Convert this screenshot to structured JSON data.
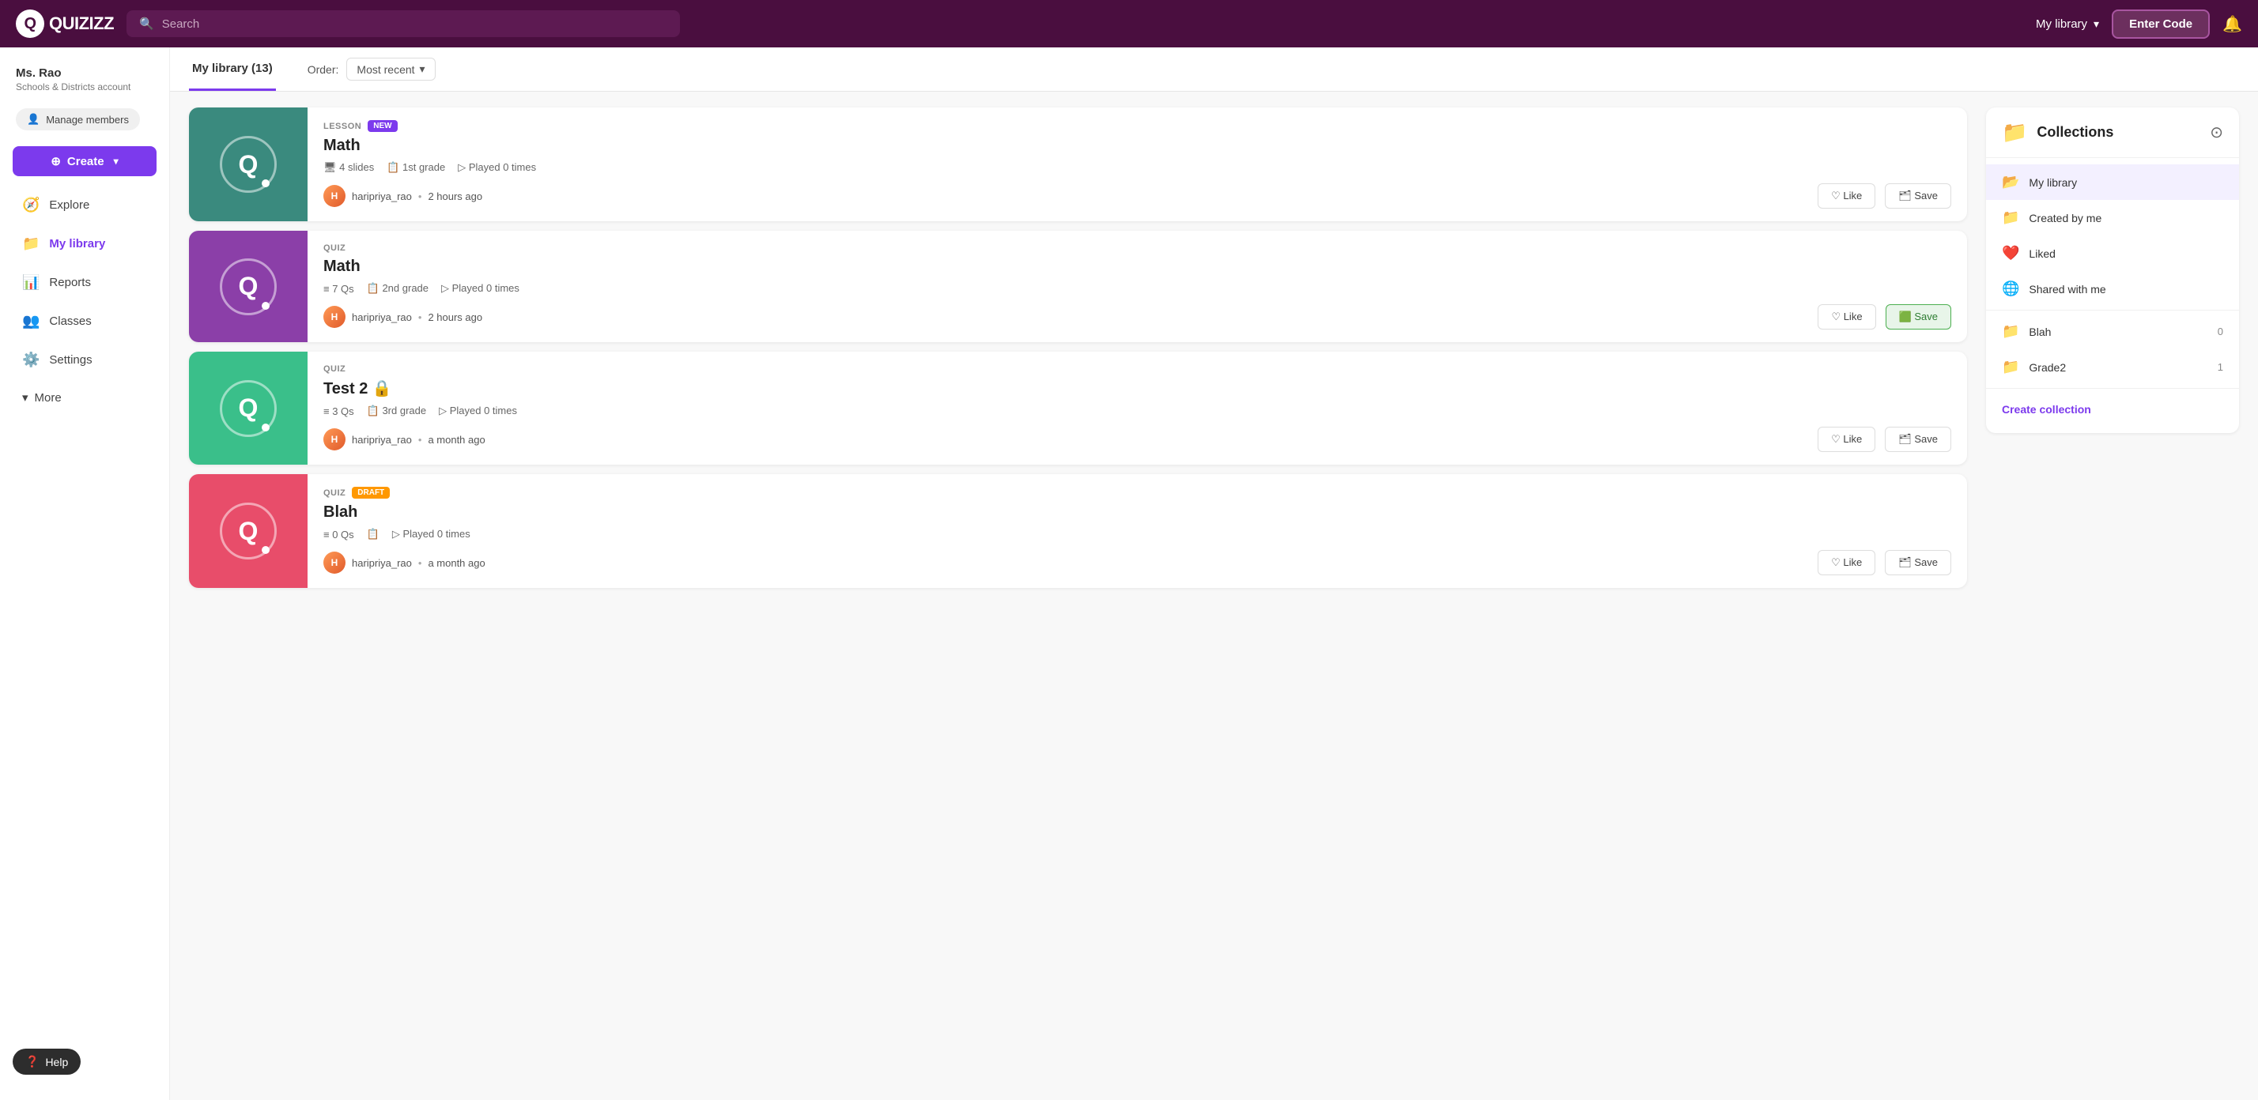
{
  "topnav": {
    "logo_text": "QUIZIZZ",
    "search_placeholder": "Search",
    "my_library_label": "My library",
    "enter_code_label": "Enter Code"
  },
  "sidebar": {
    "user_name": "Ms. Rao",
    "user_subtitle": "Schools & Districts account",
    "manage_label": "Manage members",
    "create_label": "Create",
    "nav_items": [
      {
        "label": "Explore",
        "icon": "🧭"
      },
      {
        "label": "My library",
        "icon": "📁",
        "active": true
      },
      {
        "label": "Reports",
        "icon": "📊"
      },
      {
        "label": "Classes",
        "icon": "👥"
      },
      {
        "label": "Settings",
        "icon": "⚙️"
      }
    ],
    "more_label": "More",
    "help_label": "Help"
  },
  "content": {
    "header": {
      "tab_label": "My library (13)",
      "order_label": "Order:",
      "order_value": "Most recent"
    },
    "cards": [
      {
        "id": 1,
        "type": "LESSON",
        "badge": "NEW",
        "title": "Math",
        "meta": [
          {
            "icon": "slides",
            "text": "4 slides"
          },
          {
            "icon": "grade",
            "text": "1st grade"
          },
          {
            "icon": "play",
            "text": "Played 0 times"
          }
        ],
        "author": "haripriya_rao",
        "time": "2 hours ago",
        "thumb_color": "#3a8a7e",
        "like_label": "Like",
        "save_label": "Save",
        "save_active": false
      },
      {
        "id": 2,
        "type": "QUIZ",
        "badge": "",
        "title": "Math",
        "meta": [
          {
            "icon": "list",
            "text": "7 Qs"
          },
          {
            "icon": "grade",
            "text": "2nd grade"
          },
          {
            "icon": "play",
            "text": "Played 0 times"
          }
        ],
        "author": "haripriya_rao",
        "time": "2 hours ago",
        "thumb_color": "#8b3fa8",
        "like_label": "Like",
        "save_label": "Save",
        "save_active": true
      },
      {
        "id": 3,
        "type": "QUIZ",
        "badge": "",
        "title": "Test 2",
        "locked": true,
        "meta": [
          {
            "icon": "list",
            "text": "3 Qs"
          },
          {
            "icon": "grade",
            "text": "3rd grade"
          },
          {
            "icon": "play",
            "text": "Played 0 times"
          }
        ],
        "author": "haripriya_rao",
        "time": "a month ago",
        "thumb_color": "#3abf8a",
        "like_label": "Like",
        "save_label": "Save",
        "save_active": false
      },
      {
        "id": 4,
        "type": "QUIZ",
        "badge": "DRAFT",
        "title": "Blah",
        "meta": [
          {
            "icon": "list",
            "text": "0 Qs"
          },
          {
            "icon": "grade",
            "text": ""
          },
          {
            "icon": "play",
            "text": "Played 0 times"
          }
        ],
        "author": "haripriya_rao",
        "time": "a month ago",
        "thumb_color": "#e84d6a",
        "like_label": "Like",
        "save_label": "Save",
        "save_active": false
      }
    ]
  },
  "collections": {
    "title": "Collections",
    "items": [
      {
        "name": "My library",
        "icon": "folder",
        "active": true,
        "count": ""
      },
      {
        "name": "Created by me",
        "icon": "folder",
        "active": false,
        "count": ""
      },
      {
        "name": "Liked",
        "icon": "heart",
        "active": false,
        "count": ""
      },
      {
        "name": "Shared with me",
        "icon": "globe",
        "active": false,
        "count": ""
      },
      {
        "name": "Blah",
        "icon": "folder",
        "active": false,
        "count": "0"
      },
      {
        "name": "Grade2",
        "icon": "folder",
        "active": false,
        "count": "1"
      }
    ],
    "create_label": "Create collection"
  }
}
